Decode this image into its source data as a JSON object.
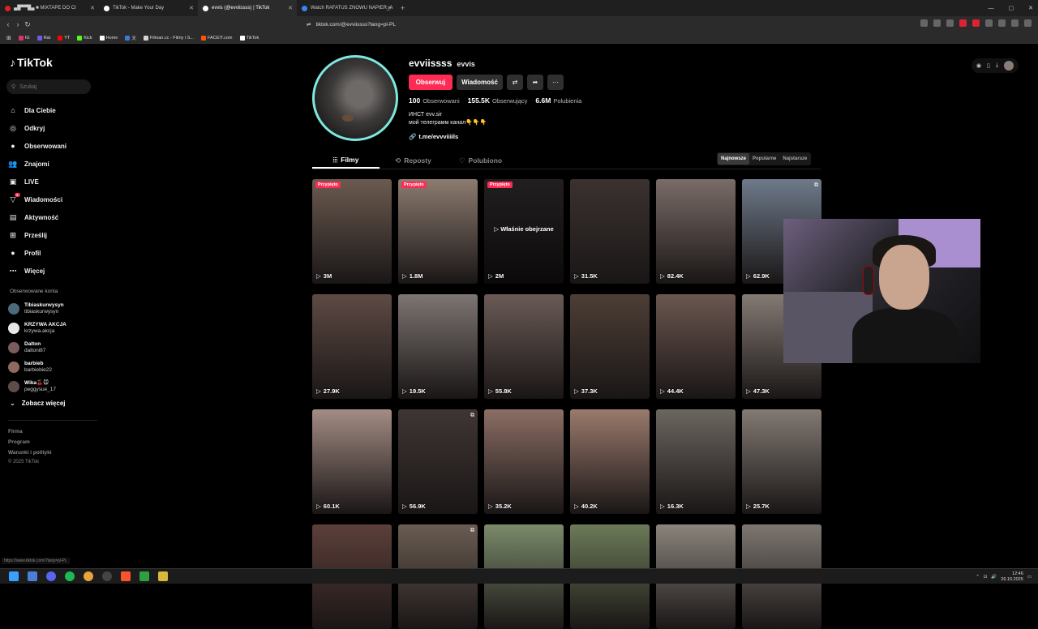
{
  "browser": {
    "tabs": [
      {
        "label": "▄█▀▀█▄ ■ MIXTAPE DO CI",
        "color": "#e02020"
      },
      {
        "label": "TikTok - Make Your Day",
        "color": "#ffffff"
      },
      {
        "label": "evvis (@evviissss) | TikTok",
        "color": "#ffffff",
        "active": true
      },
      {
        "label": "Watch RAFATUS ZNOWU NAPIER_A",
        "color": "#3b82f6"
      }
    ],
    "new_tab": "+",
    "url": "tiktok.com/@evviissss?lang=pl-PL",
    "bookmarks": [
      {
        "label": "IG",
        "color": "#e1306c"
      },
      {
        "label": "Rat",
        "color": "#6c5ce7"
      },
      {
        "label": "YT",
        "color": "#ff0000"
      },
      {
        "label": "Kick",
        "color": "#53fc18"
      },
      {
        "label": "Home",
        "color": "#ffffff"
      },
      {
        "label": "天",
        "color": "#3a7bd5"
      },
      {
        "label": "Filman.cc - Filmy i S...",
        "color": "#d4d4d4"
      },
      {
        "label": "FACEIT.com",
        "color": "#ff5500"
      },
      {
        "label": "TikTok",
        "color": "#ffffff"
      }
    ]
  },
  "sidebar": {
    "logo": "TikTok",
    "search_placeholder": "Szukaj",
    "nav": [
      {
        "label": "Dla Ciebie",
        "icon": "home-icon",
        "glyph": "⌂"
      },
      {
        "label": "Odkryj",
        "icon": "compass-icon",
        "glyph": "◎"
      },
      {
        "label": "Obserwowani",
        "icon": "following-avatar-icon",
        "glyph": "●"
      },
      {
        "label": "Znajomi",
        "icon": "friends-icon",
        "glyph": "👥"
      },
      {
        "label": "LIVE",
        "icon": "live-icon",
        "glyph": "▣"
      },
      {
        "label": "Wiadomości",
        "icon": "messages-icon",
        "glyph": "▽"
      },
      {
        "label": "Aktywność",
        "icon": "activity-icon",
        "glyph": "▤"
      },
      {
        "label": "Prześlij",
        "icon": "upload-icon",
        "glyph": "⊞"
      },
      {
        "label": "Profil",
        "icon": "profile-avatar-icon",
        "glyph": "●"
      },
      {
        "label": "Więcej",
        "icon": "more-icon",
        "glyph": "⋯"
      }
    ],
    "messages_badge": "2",
    "followed_label": "Obserwowane konta",
    "followed": [
      {
        "name": "Tibiaskurwysyn",
        "user": "tibiaskurwysyn",
        "color": "#4b6b7a"
      },
      {
        "name": "KRZYWA AKCJA",
        "user": "krzywa.akcja",
        "color": "#e8e8e8"
      },
      {
        "name": "Dalton",
        "user": "daltoni87",
        "color": "#7a5c5c"
      },
      {
        "name": "barbieb",
        "user": "barbiebie22",
        "color": "#8e6b61"
      },
      {
        "name": "Wika🍒🐭",
        "user": "peggysue_17",
        "color": "#5c4d4a"
      }
    ],
    "see_more": "Zobacz więcej",
    "footer": [
      "Firma",
      "Program",
      "Warunki i polityki"
    ],
    "copyright": "© 2025 TikTok"
  },
  "profile": {
    "username": "evviissss",
    "nickname": "evvis",
    "follow_btn": "Obserwuj",
    "message_btn": "Wiadomość",
    "stats": [
      {
        "value": "100",
        "label": "Obserwowani"
      },
      {
        "value": "155.5K",
        "label": "Obserwujący"
      },
      {
        "value": "6.6M",
        "label": "Polubienia"
      }
    ],
    "bio_line1": "ИНСТ evv.sir",
    "bio_line2": "мой телеграмм канал👇👇👇",
    "link": "t.me/evvviiiils",
    "tabs": [
      "Filmy",
      "Reposty",
      "Polubiono"
    ],
    "sort": [
      "Najnowsze",
      "Popularne",
      "Najstarsze"
    ]
  },
  "videos": [
    {
      "views": "3M",
      "pinned": "Przypięto",
      "color": "#6b5a50"
    },
    {
      "views": "1.8M",
      "pinned": "Przypięto",
      "color": "#8c7b70"
    },
    {
      "views": "2M",
      "pinned": "Przypięto",
      "watched": "Właśnie obejrzane",
      "color": "#4a4645"
    },
    {
      "views": "31.5K",
      "color": "#3b3230"
    },
    {
      "views": "82.4K",
      "color": "#7a6c68"
    },
    {
      "views": "62.9K",
      "multi": true,
      "color": "#6e7a8a"
    },
    {
      "views": "27.9K",
      "color": "#5e4a44"
    },
    {
      "views": "19.5K",
      "color": "#7d7572"
    },
    {
      "views": "55.8K",
      "color": "#6a5a56"
    },
    {
      "views": "37.3K",
      "color": "#4d3e36"
    },
    {
      "views": "44.4K",
      "color": "#6b5650"
    },
    {
      "views": "47.3K",
      "color": "#847a74"
    },
    {
      "views": "60.1K",
      "color": "#a48c84"
    },
    {
      "views": "56.9K",
      "multi": true,
      "color": "#3f3634"
    },
    {
      "views": "35.2K",
      "color": "#8b6e64"
    },
    {
      "views": "40.2K",
      "color": "#9a7a6c"
    },
    {
      "views": "16.3K",
      "color": "#6c6660"
    },
    {
      "views": "25.7K",
      "color": "#827a73"
    },
    {
      "views": "",
      "color": "#5c3f3a"
    },
    {
      "views": "",
      "multi": true,
      "color": "#6a5c52"
    },
    {
      "views": "",
      "color": "#7a8a6a"
    },
    {
      "views": "",
      "color": "#6c7a58"
    },
    {
      "views": "",
      "color": "#8a847c"
    },
    {
      "views": "",
      "color": "#7d7670"
    }
  ],
  "taskbar": {
    "time": "12:46",
    "date": "26.10.2025",
    "status_url": "https://www.tiktok.com/?lang=pl-PL"
  }
}
